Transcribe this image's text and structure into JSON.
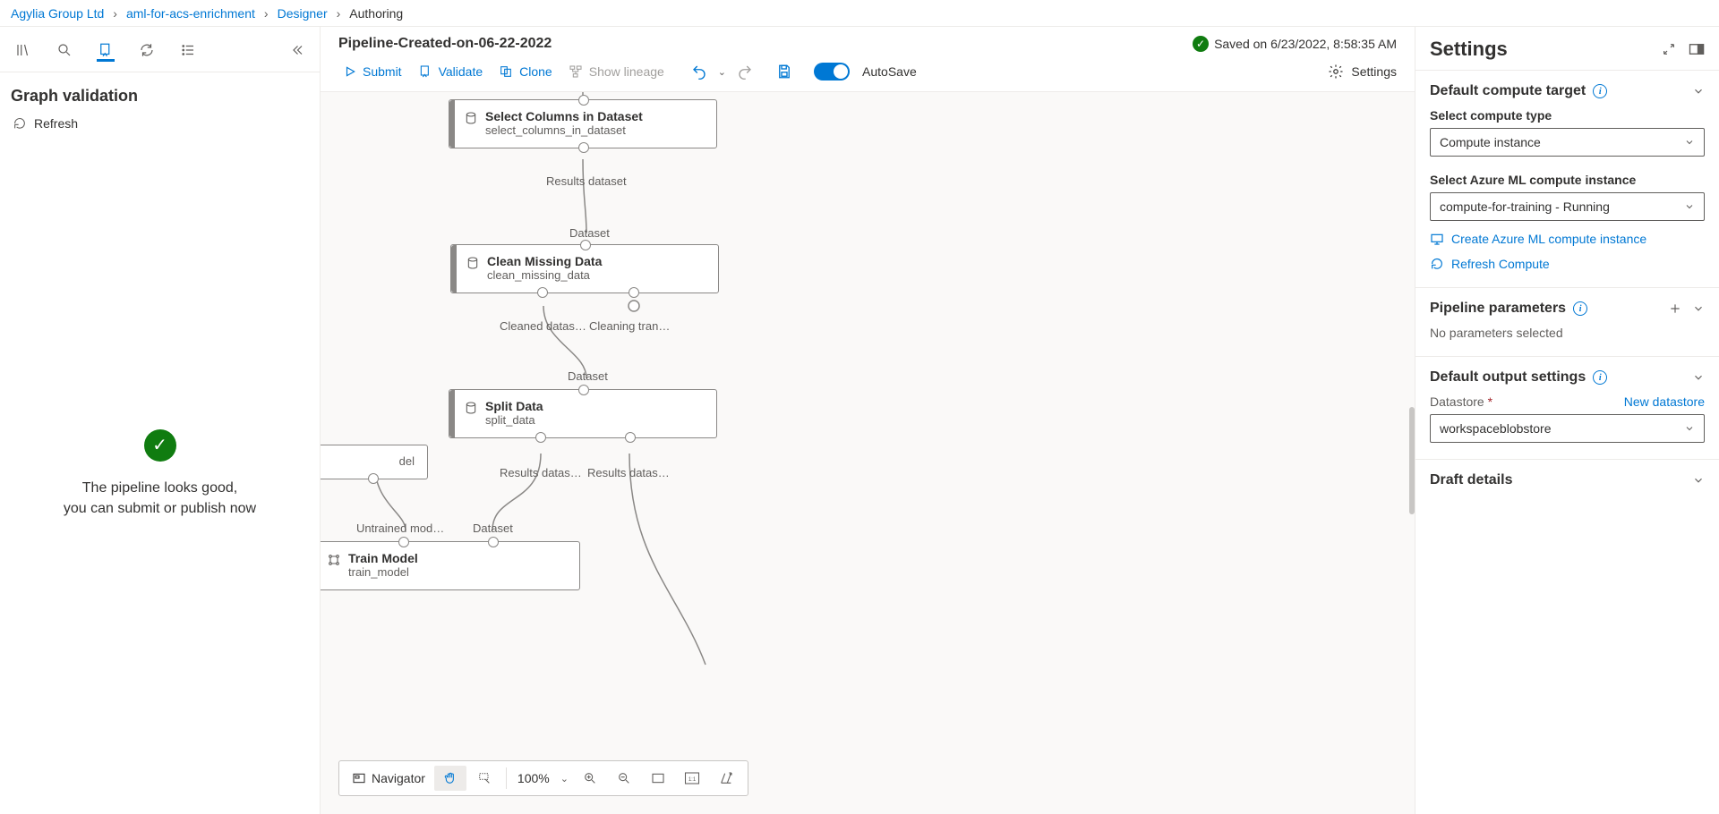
{
  "breadcrumb": {
    "org": "Agylia Group Ltd",
    "workspace": "aml-for-acs-enrichment",
    "section": "Designer",
    "page": "Authoring"
  },
  "doc": {
    "title": "Pipeline-Created-on-06-22-2022",
    "saved": "Saved on 6/23/2022, 8:58:35 AM"
  },
  "toolbar": {
    "submit": "Submit",
    "validate": "Validate",
    "clone": "Clone",
    "lineage": "Show lineage",
    "autosave": "AutoSave",
    "settings": "Settings"
  },
  "left": {
    "heading": "Graph validation",
    "refresh": "Refresh",
    "ok_line1": "The pipeline looks good,",
    "ok_line2": "you can submit or publish now"
  },
  "canvas": {
    "nodes": {
      "select_cols": {
        "title": "Select Columns in Dataset",
        "sub": "select_columns_in_dataset",
        "out1": "Results dataset"
      },
      "clean": {
        "title": "Clean Missing Data",
        "sub": "clean_missing_data",
        "in1": "Dataset",
        "out1": "Cleaned datas…",
        "out2": "Cleaning tran…"
      },
      "split": {
        "title": "Split Data",
        "sub": "split_data",
        "in1": "Dataset",
        "out1": "Results datas…",
        "out2": "Results datas…"
      },
      "partial_left": {
        "sub": "del"
      },
      "train": {
        "title": "Train Model",
        "sub": "train_model",
        "in1": "Untrained mod…",
        "in2": "Dataset"
      }
    },
    "zoom": "100%",
    "nav": "Navigator"
  },
  "settings": {
    "heading": "Settings",
    "compute": {
      "section": "Default compute target",
      "type_label": "Select compute type",
      "type_value": "Compute instance",
      "inst_label": "Select Azure ML compute instance",
      "inst_value": "compute-for-training - Running",
      "create": "Create Azure ML compute instance",
      "refresh": "Refresh Compute"
    },
    "params": {
      "section": "Pipeline parameters",
      "none": "No parameters selected"
    },
    "output": {
      "section": "Default output settings",
      "datastore_lbl": "Datastore",
      "new": "New datastore",
      "value": "workspaceblobstore"
    },
    "draft": {
      "section": "Draft details"
    }
  }
}
